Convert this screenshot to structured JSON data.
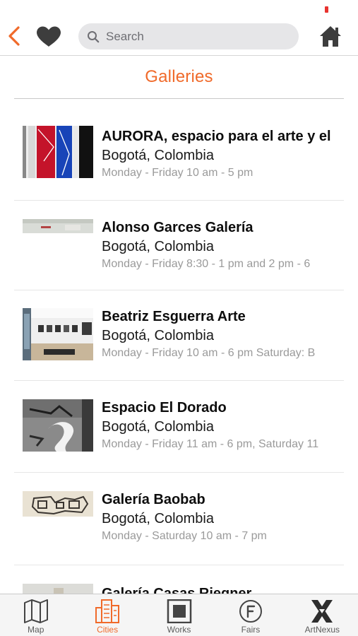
{
  "colors": {
    "accent": "#f06a2a",
    "status_red": "#e8332f"
  },
  "nav": {
    "back_icon": "chevron-left-icon",
    "favorite_icon": "heart-icon",
    "search": {
      "placeholder": "Search",
      "value": ""
    },
    "home_icon": "home-icon"
  },
  "page": {
    "title": "Galleries"
  },
  "galleries": [
    {
      "name": "AURORA, espacio para el arte y el",
      "city": "Bogotá, Colombia",
      "hours": "Monday - Friday 10 am - 5 pm"
    },
    {
      "name": "Alonso Garces Galería",
      "city": "Bogotá, Colombia",
      "hours": "Monday - Friday 8:30 - 1 pm and 2 pm - 6"
    },
    {
      "name": "Beatriz Esguerra Arte",
      "city": "Bogotá, Colombia",
      "hours": "Monday - Friday 10 am - 6 pm Saturday: B"
    },
    {
      "name": "Espacio El Dorado",
      "city": "Bogotá, Colombia",
      "hours": "Monday - Friday 11 am - 6 pm, Saturday 11"
    },
    {
      "name": "Galería Baobab",
      "city": "Bogotá, Colombia",
      "hours": "Monday - Saturday 10 am - 7 pm"
    },
    {
      "name": "Galería Casas Riegner",
      "city": "",
      "hours": ""
    }
  ],
  "tabbar": {
    "tabs": [
      {
        "label": "Map",
        "icon": "map-icon",
        "active": false
      },
      {
        "label": "Cities",
        "icon": "city-buildings-icon",
        "active": true
      },
      {
        "label": "Works",
        "icon": "works-frame-icon",
        "active": false
      },
      {
        "label": "Fairs",
        "icon": "fairs-f-circle-icon",
        "active": false
      },
      {
        "label": "ArtNexus",
        "icon": "artnexus-x-logo-icon",
        "active": false
      }
    ]
  }
}
